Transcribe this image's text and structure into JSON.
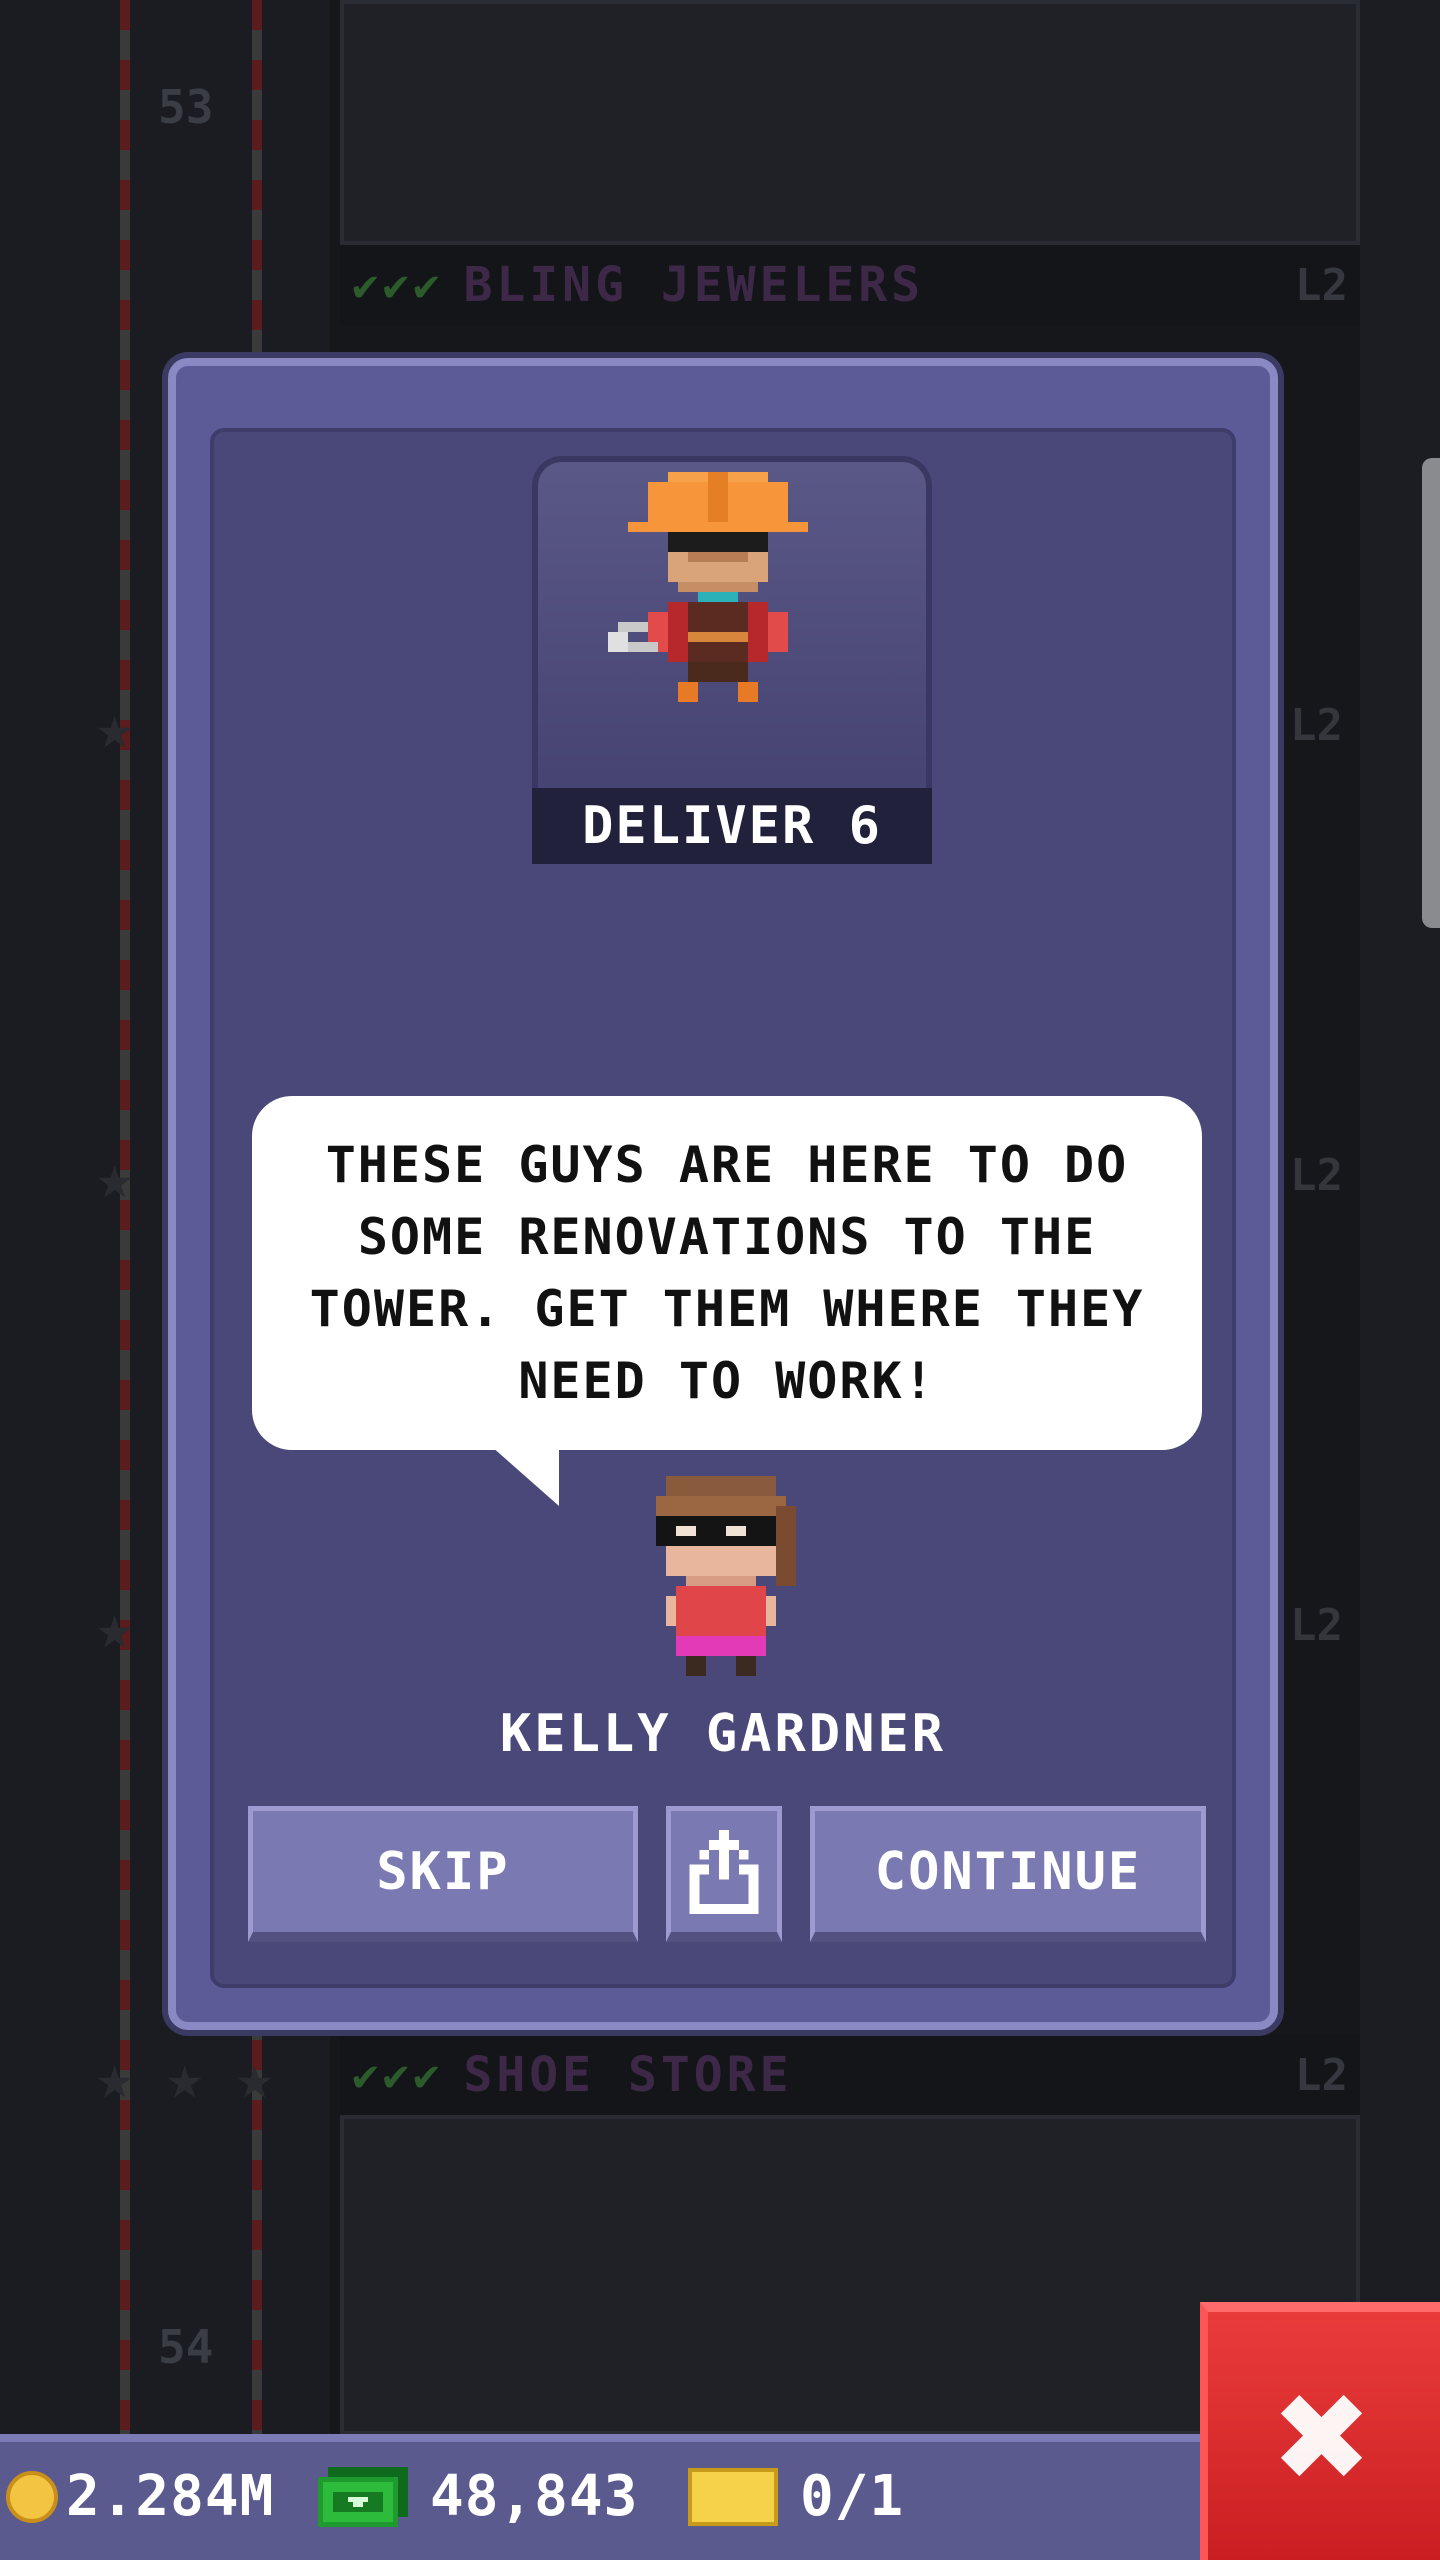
{
  "background": {
    "floors": [
      {
        "number": "53",
        "label": "BLING JEWELERS",
        "level": "L2"
      },
      {
        "number": "54",
        "label": "SHOE STORE",
        "level": "L2"
      }
    ],
    "side_levels": [
      "L2",
      "L2",
      "L2"
    ]
  },
  "dialog": {
    "quest_label": "DELIVER 6",
    "message": "THESE GUYS ARE HERE TO DO SOME RENOVATIONS TO THE TOWER. GET THEM WHERE THEY NEED TO WORK!",
    "npc_name": "KELLY GARDNER",
    "buttons": {
      "skip": "SKIP",
      "continue": "CONTINUE",
      "share_icon": "share-icon"
    }
  },
  "status_bar": {
    "coins": "2.284M",
    "bux": "48,843",
    "tickets": "0/1"
  },
  "close_icon": "close-icon",
  "colors": {
    "dialog_bg": "#5d5b97",
    "dialog_inner": "#4a4878",
    "button_bg": "#7b79b2",
    "close_red": "#d62a2d",
    "coin_gold": "#f3c342",
    "bux_green": "#1e9a2e"
  }
}
